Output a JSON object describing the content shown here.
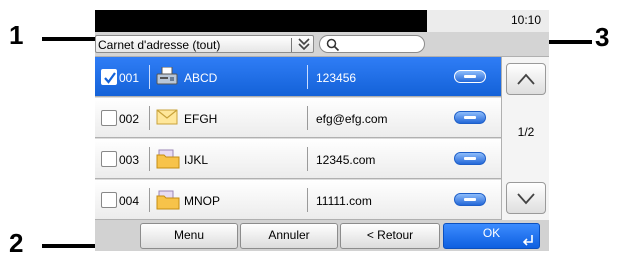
{
  "callouts": {
    "c1": "1",
    "c2": "2",
    "c3": "3"
  },
  "status": {
    "time": "10:10"
  },
  "toolbar": {
    "address_book": "Carnet d'adresse (tout)",
    "dropdown_icon": "double-chevron-down-icon",
    "search_placeholder": ""
  },
  "rows": [
    {
      "selected": true,
      "checked": true,
      "number": "001",
      "type": "fax-icon",
      "name": "ABCD",
      "destination": "123456"
    },
    {
      "selected": false,
      "checked": false,
      "number": "002",
      "type": "email-icon",
      "name": "EFGH",
      "destination": "efg@efg.com"
    },
    {
      "selected": false,
      "checked": false,
      "number": "003",
      "type": "folder-icon",
      "name": "IJKL",
      "destination": "12345.com"
    },
    {
      "selected": false,
      "checked": false,
      "number": "004",
      "type": "folder-icon",
      "name": "MNOP",
      "destination": "11111.com"
    }
  ],
  "scroll": {
    "page": "1/2"
  },
  "buttons": {
    "menu": "Menu",
    "cancel": "Annuler",
    "back": "< Retour",
    "ok": "OK"
  },
  "colors": {
    "selection": "#1a6ae6",
    "ok_button": "#0e5fe0"
  }
}
